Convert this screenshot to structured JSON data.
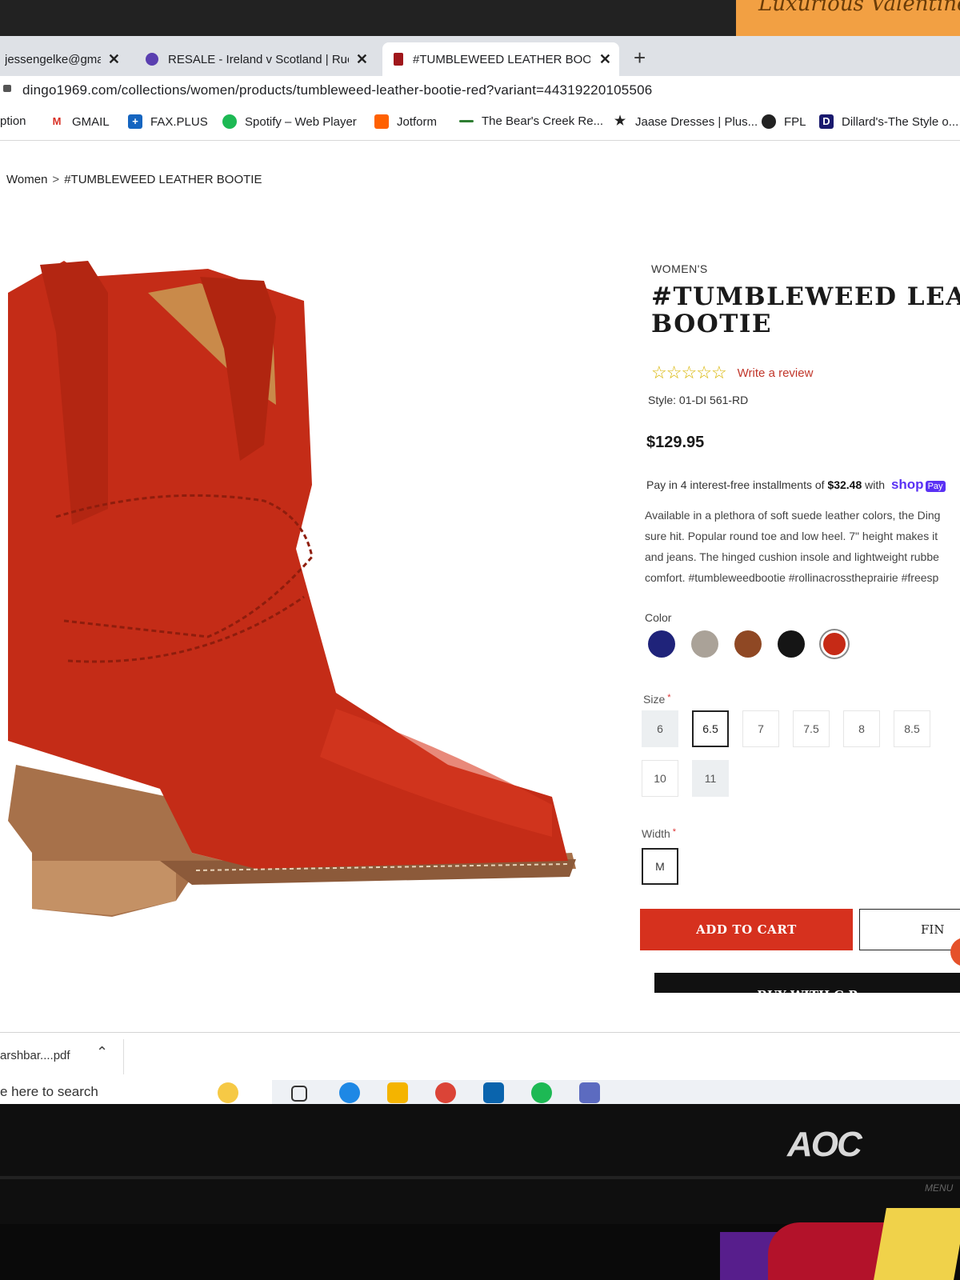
{
  "desk": {
    "sticky_note_text": "Luxurious Valentine",
    "monitor_brand": "AOC",
    "monitor_menu_label": "MENU"
  },
  "browser": {
    "tabs": [
      {
        "label": "jessengelke@gma",
        "active": false
      },
      {
        "label": "RESALE - Ireland v Scotland | Ruc",
        "active": false
      },
      {
        "label": "#TUMBLEWEED LEATHER BOOTIE",
        "active": true
      }
    ],
    "new_tab": "+",
    "close": "✕",
    "url": "dingo1969.com/collections/women/products/tumbleweed-leather-bootie-red?variant=44319220105506",
    "bookmarks": [
      {
        "label": "ption",
        "icon": "none"
      },
      {
        "label": "GMAIL",
        "icon": "gmail-icon"
      },
      {
        "label": "FAX.PLUS",
        "icon": "faxplus-icon"
      },
      {
        "label": "Spotify – Web Player",
        "icon": "spotify-icon"
      },
      {
        "label": "Jotform",
        "icon": "jotform-icon"
      },
      {
        "label": "The Bear's Creek Re...",
        "icon": "bearscreek-icon"
      },
      {
        "label": "Jaase Dresses | Plus...",
        "icon": "star-icon"
      },
      {
        "label": "FPL",
        "icon": "fpl-icon"
      },
      {
        "label": "Dillard's-The Style o...",
        "icon": "dillards-icon"
      }
    ]
  },
  "breadcrumb": {
    "parent": "Women",
    "separator": ">",
    "current": "#TUMBLEWEED LEATHER BOOTIE"
  },
  "product": {
    "kicker": "WOMEN'S",
    "title": "#TUMBLEWEED LEA\nBOOTIE",
    "rating": 0,
    "rating_max": 5,
    "review_link": "Write a review",
    "style": "Style: 01-DI 561-RD",
    "price": "$129.95",
    "installments_prefix": "Pay in 4 interest-free installments of",
    "installments_amount": "$32.48",
    "installments_with": "with",
    "shop_logo": "shop",
    "shop_pay": "Pay",
    "description_lines": [
      "Available in a plethora of soft suede leather colors, the Ding",
      "sure hit. Popular round toe and low heel. 7\" height makes it",
      "and jeans. The hinged cushion insole and lightweight rubbe",
      "comfort. #tumbleweedbootie #rollinacrosstheprairie #freesp"
    ],
    "color_label": "Color",
    "colors": [
      {
        "name": "navy",
        "hex": "#1f237a"
      },
      {
        "name": "taupe",
        "hex": "#aaa298"
      },
      {
        "name": "brown",
        "hex": "#8f4824"
      },
      {
        "name": "black",
        "hex": "#151515"
      },
      {
        "name": "red",
        "hex": "#c62a16",
        "selected": true
      }
    ],
    "size_label": "Size",
    "required_mark": "*",
    "sizes": [
      {
        "label": "6",
        "state": "unavailable"
      },
      {
        "label": "6.5",
        "state": "selected"
      },
      {
        "label": "7",
        "state": "available"
      },
      {
        "label": "7.5",
        "state": "available"
      },
      {
        "label": "8",
        "state": "available"
      },
      {
        "label": "8.5",
        "state": "available"
      },
      {
        "label": "10",
        "state": "available"
      },
      {
        "label": "11",
        "state": "unavailable"
      }
    ],
    "width_label": "Width",
    "width_value": "M",
    "add_to_cart": "ADD TO CART",
    "find_in_store": "FIN",
    "buy_with": "BUY WITH G Pay"
  },
  "downloads": {
    "file": "arshbar....pdf"
  },
  "taskbar": {
    "search_placeholder": "e here to search"
  },
  "colors": {
    "accent_red": "#d6311e",
    "star_yellow": "#d9b500",
    "shop_purple": "#5a31f4"
  }
}
